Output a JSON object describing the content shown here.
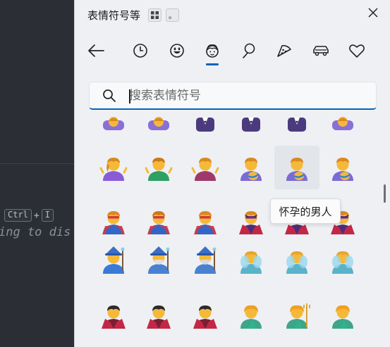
{
  "editor": {
    "keys": [
      "Ctrl",
      "I"
    ],
    "plus": "+",
    "hint_text": "ing to dis"
  },
  "panel": {
    "title": "表情符号等",
    "grid_button_icon": "grid-icon",
    "kaomoji_button_label": "。",
    "close_icon": "close-icon",
    "tabs": [
      {
        "name": "back",
        "icon": "back-arrow-icon"
      },
      {
        "name": "recent",
        "icon": "clock-icon"
      },
      {
        "name": "smileys",
        "icon": "smiley-icon"
      },
      {
        "name": "people",
        "icon": "person-face-icon",
        "selected": true
      },
      {
        "name": "celebration",
        "icon": "balloon-icon"
      },
      {
        "name": "food",
        "icon": "pizza-icon"
      },
      {
        "name": "travel",
        "icon": "car-icon"
      },
      {
        "name": "symbols",
        "icon": "heart-icon"
      }
    ],
    "search_placeholder": "搜索表情符号",
    "tooltip": "怀孕的男人",
    "accent_color": "#0a63b5",
    "emoji_rows": [
      [
        "woman-getting-massage",
        "woman-getting-massage",
        "person-in-tuxedo",
        "person-in-tuxedo",
        "person-in-tuxedo",
        "woman-getting-massage"
      ],
      [
        "woman-shrugging",
        "man-shrugging",
        "person-shrugging",
        "pregnant-woman",
        "pregnant-man",
        "pregnant-person"
      ],
      [
        "woman-superhero",
        "man-superhero",
        "superhero",
        "woman-supervillain",
        "man-supervillain",
        "supervillain"
      ],
      [
        "woman-mage",
        "man-mage",
        "mage",
        "woman-fairy",
        "man-fairy",
        "fairy"
      ],
      [
        "woman-vampire",
        "man-vampire",
        "vampire",
        "mermaid",
        "merman",
        "merperson"
      ]
    ]
  }
}
